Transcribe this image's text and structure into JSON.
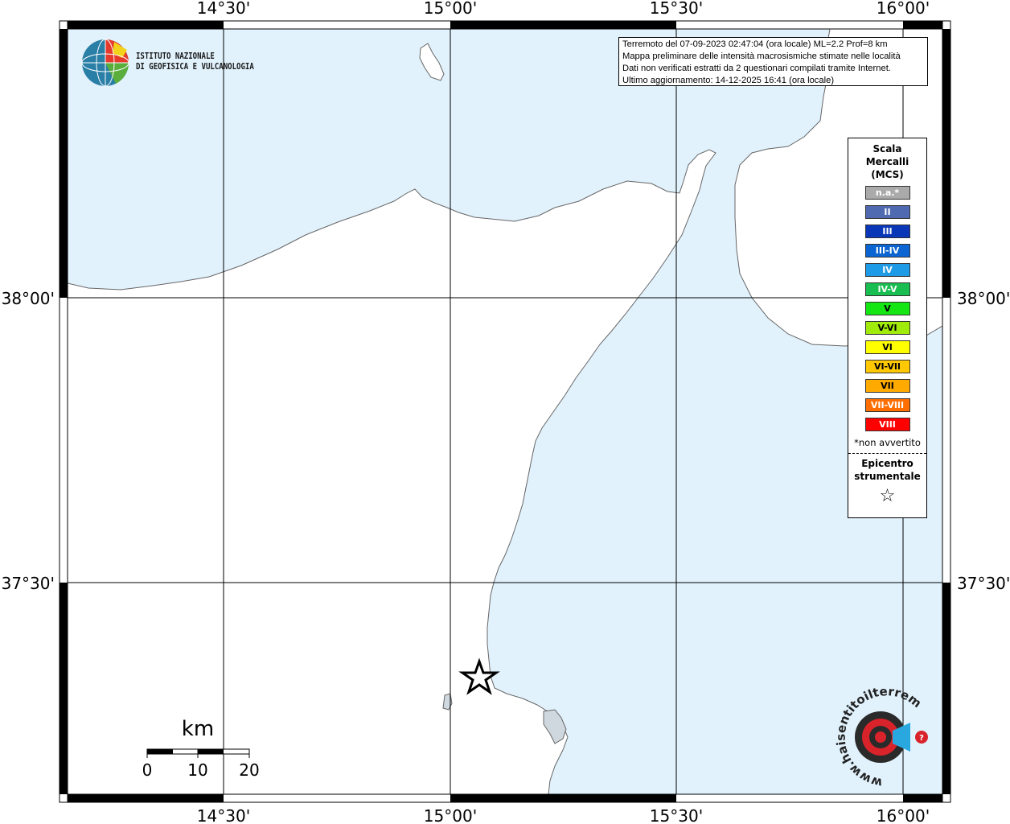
{
  "map": {
    "lon_labels": [
      "14°30'",
      "15°00'",
      "15°30'",
      "16°00'"
    ],
    "lat_labels": [
      "38°00'",
      "37°30'"
    ],
    "colors": {
      "sea": "#e1f2fd",
      "land": "#ffffff",
      "coast": "#666666",
      "grid": "#000000"
    },
    "epicenter_symbol": "star-icon"
  },
  "logo": {
    "line1": "ISTITUTO NAZIONALE",
    "line2": "DI GEOFISICA E VULCANOLOGIA"
  },
  "info": {
    "line1": "Terremoto del 07-09-2023 02:47:04 (ora locale) ML=2.2 Prof=8 km",
    "line2": "Mappa preliminare delle intensità macrosismiche stimate nelle località",
    "line3": "Dati non verificati estratti da 2 questionari compilati tramite Internet.",
    "line4": "Ultimo aggiornamento: 14-12-2025 16:41 (ora locale)"
  },
  "legend": {
    "title1": "Scala",
    "title2": "Mercalli",
    "title3": "(MCS)",
    "items": [
      {
        "label": "n.a.*",
        "color": "#aaaaaa"
      },
      {
        "label": "II",
        "color": "#4f6ab0"
      },
      {
        "label": "III",
        "color": "#0a37b8"
      },
      {
        "label": "III-IV",
        "color": "#0a64d2"
      },
      {
        "label": "IV",
        "color": "#1e9be6"
      },
      {
        "label": "IV-V",
        "color": "#19be50"
      },
      {
        "label": "V",
        "color": "#14e614"
      },
      {
        "label": "V-VI",
        "color": "#a0eb0a"
      },
      {
        "label": "VI",
        "color": "#ffff00"
      },
      {
        "label": "VI-VII",
        "color": "#ffc800"
      },
      {
        "label": "VII",
        "color": "#ffaa00"
      },
      {
        "label": "VII-VIII",
        "color": "#ff6e00"
      },
      {
        "label": "VIII",
        "color": "#ff0000"
      }
    ],
    "note": "*non avvertito",
    "epi1": "Epicentro",
    "epi2": "strumentale"
  },
  "scale": {
    "unit": "km",
    "ticks": [
      "0",
      "10",
      "20"
    ]
  },
  "badge": {
    "text": "www.haisentitoilterremoto.it"
  }
}
